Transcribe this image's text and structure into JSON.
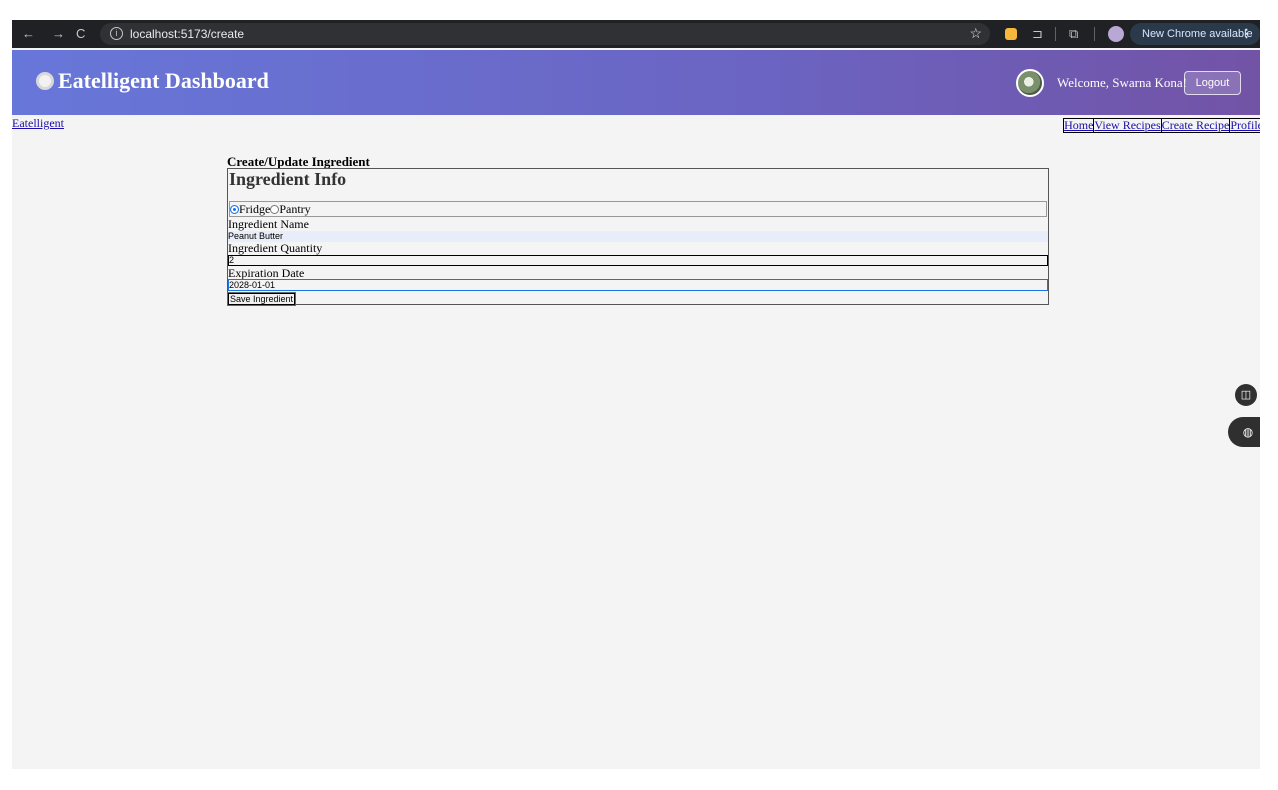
{
  "browser": {
    "back": "←",
    "forward": "→",
    "reload": "C",
    "url": "localhost:5173/create",
    "info_icon": "i",
    "bookmark": "☆",
    "extension": "⊐",
    "tab_search": "⧉",
    "update_label": "New Chrome available",
    "menu": "⋮"
  },
  "header": {
    "title": "Eatelligent Dashboard",
    "welcome": "Welcome, Swarna Kona!",
    "logout_label": "Logout"
  },
  "nav": {
    "brand": "Eatelligent",
    "links": [
      "Home",
      "View Recipes",
      "Create Recipe",
      "Profile"
    ]
  },
  "form": {
    "page_title": "Create/Update Ingredient",
    "section_title": "Ingredient Info",
    "storage_options": [
      "Fridge",
      "Pantry"
    ],
    "storage_selected": "Fridge",
    "name_label": "Ingredient Name",
    "name_value": "Peanut Butter",
    "quantity_label": "Ingredient Quantity",
    "quantity_value": "2",
    "expiration_label": "Expiration Date",
    "expiration_value": "2028-01-01",
    "save_label": "Save Ingredient"
  },
  "side": {
    "book_icon": "◫",
    "palette_icon": "◍"
  },
  "colors": {
    "header_gradient_start": "#6777d9",
    "header_gradient_end": "#7253a6",
    "link": "#1a0dab",
    "focus": "#1a73e8"
  }
}
